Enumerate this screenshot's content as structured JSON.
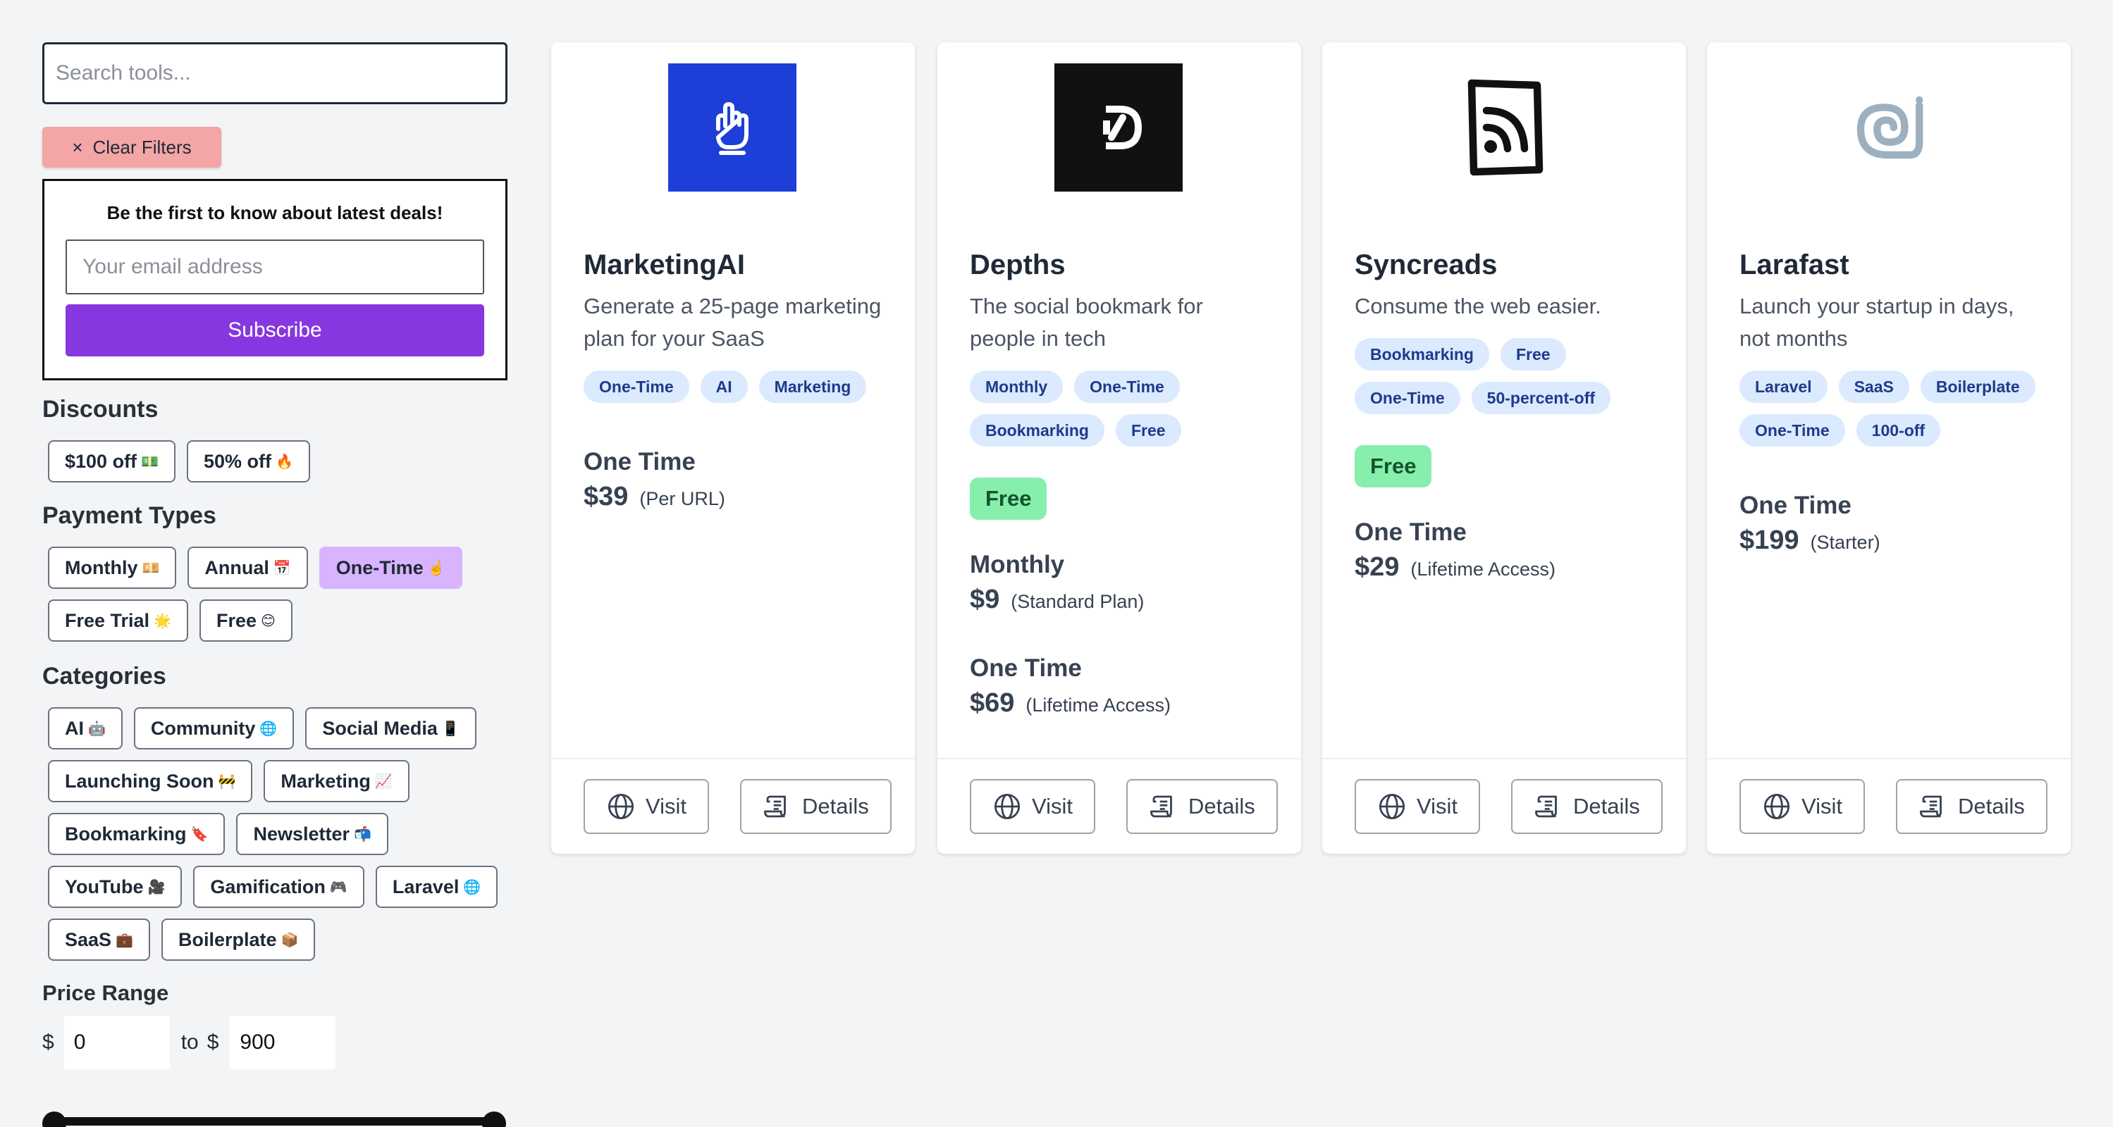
{
  "sidebar": {
    "search_placeholder": "Search tools...",
    "clear_filters": {
      "icon": "×",
      "label": "Clear Filters"
    },
    "newsletter": {
      "heading": "Be the first to know about latest deals!",
      "email_placeholder": "Your email address",
      "subscribe_label": "Subscribe"
    },
    "discounts": {
      "title": "Discounts",
      "items": [
        {
          "label": "$100 off",
          "emoji": "💵"
        },
        {
          "label": "50% off",
          "emoji": "🔥"
        }
      ]
    },
    "payment_types": {
      "title": "Payment Types",
      "items": [
        {
          "label": "Monthly",
          "emoji": "💴"
        },
        {
          "label": "Annual",
          "emoji": "📅"
        },
        {
          "label": "One-Time",
          "emoji": "☝️",
          "active": true
        },
        {
          "label": "Free Trial",
          "emoji": "🌟"
        },
        {
          "label": "Free",
          "emoji": "😊"
        }
      ]
    },
    "categories": {
      "title": "Categories",
      "items": [
        {
          "label": "AI",
          "emoji": "🤖"
        },
        {
          "label": "Community",
          "emoji": "🌐"
        },
        {
          "label": "Social Media",
          "emoji": "📱"
        },
        {
          "label": "Launching Soon",
          "emoji": "🚧"
        },
        {
          "label": "Marketing",
          "emoji": "📈"
        },
        {
          "label": "Bookmarking",
          "emoji": "🔖"
        },
        {
          "label": "Newsletter",
          "emoji": "📬"
        },
        {
          "label": "YouTube",
          "emoji": "🎥"
        },
        {
          "label": "Gamification",
          "emoji": "🎮"
        },
        {
          "label": "Laravel",
          "emoji": "🌐"
        },
        {
          "label": "SaaS",
          "emoji": "💼"
        },
        {
          "label": "Boilerplate",
          "emoji": "📦"
        }
      ]
    },
    "price_range": {
      "title": "Price Range",
      "currency": "$",
      "min": "0",
      "to_label": "to",
      "max": "900"
    }
  },
  "cards": [
    {
      "name": "MarketingAI",
      "description": "Generate a 25-page marketing plan for your SaaS",
      "logo_icon": "hand-gesture-icon",
      "logo_bg": "#1d3fd8",
      "tags": [
        "One-Time",
        "AI",
        "Marketing"
      ],
      "badge": "",
      "plans": [
        {
          "name": "One Time",
          "price": "$39",
          "note": "(Per URL)"
        }
      ],
      "visit_label": "Visit",
      "details_label": "Details"
    },
    {
      "name": "Depths",
      "description": "The social bookmark for people in tech",
      "logo_icon": "depths-d-icon",
      "logo_bg": "#111111",
      "tags": [
        "Monthly",
        "One-Time",
        "Bookmarking",
        "Free"
      ],
      "badge": "Free",
      "plans": [
        {
          "name": "Monthly",
          "price": "$9",
          "note": "(Standard Plan)"
        },
        {
          "name": "One Time",
          "price": "$69",
          "note": "(Lifetime Access)"
        }
      ],
      "visit_label": "Visit",
      "details_label": "Details"
    },
    {
      "name": "Syncreads",
      "description": "Consume the web easier.",
      "logo_icon": "rss-document-icon",
      "logo_bg": "#ffffff",
      "tags": [
        "Bookmarking",
        "Free",
        "One-Time",
        "50-percent-off"
      ],
      "badge": "Free",
      "plans": [
        {
          "name": "One Time",
          "price": "$29",
          "note": "(Lifetime Access)"
        }
      ],
      "visit_label": "Visit",
      "details_label": "Details"
    },
    {
      "name": "Larafast",
      "description": "Launch your startup in days, not months",
      "logo_icon": "snail-swirl-icon",
      "logo_bg": "#ffffff",
      "tags": [
        "Laravel",
        "SaaS",
        "Boilerplate",
        "One-Time",
        "100-off"
      ],
      "badge": "",
      "plans": [
        {
          "name": "One Time",
          "price": "$199",
          "note": "(Starter)"
        }
      ],
      "visit_label": "Visit",
      "details_label": "Details"
    }
  ]
}
